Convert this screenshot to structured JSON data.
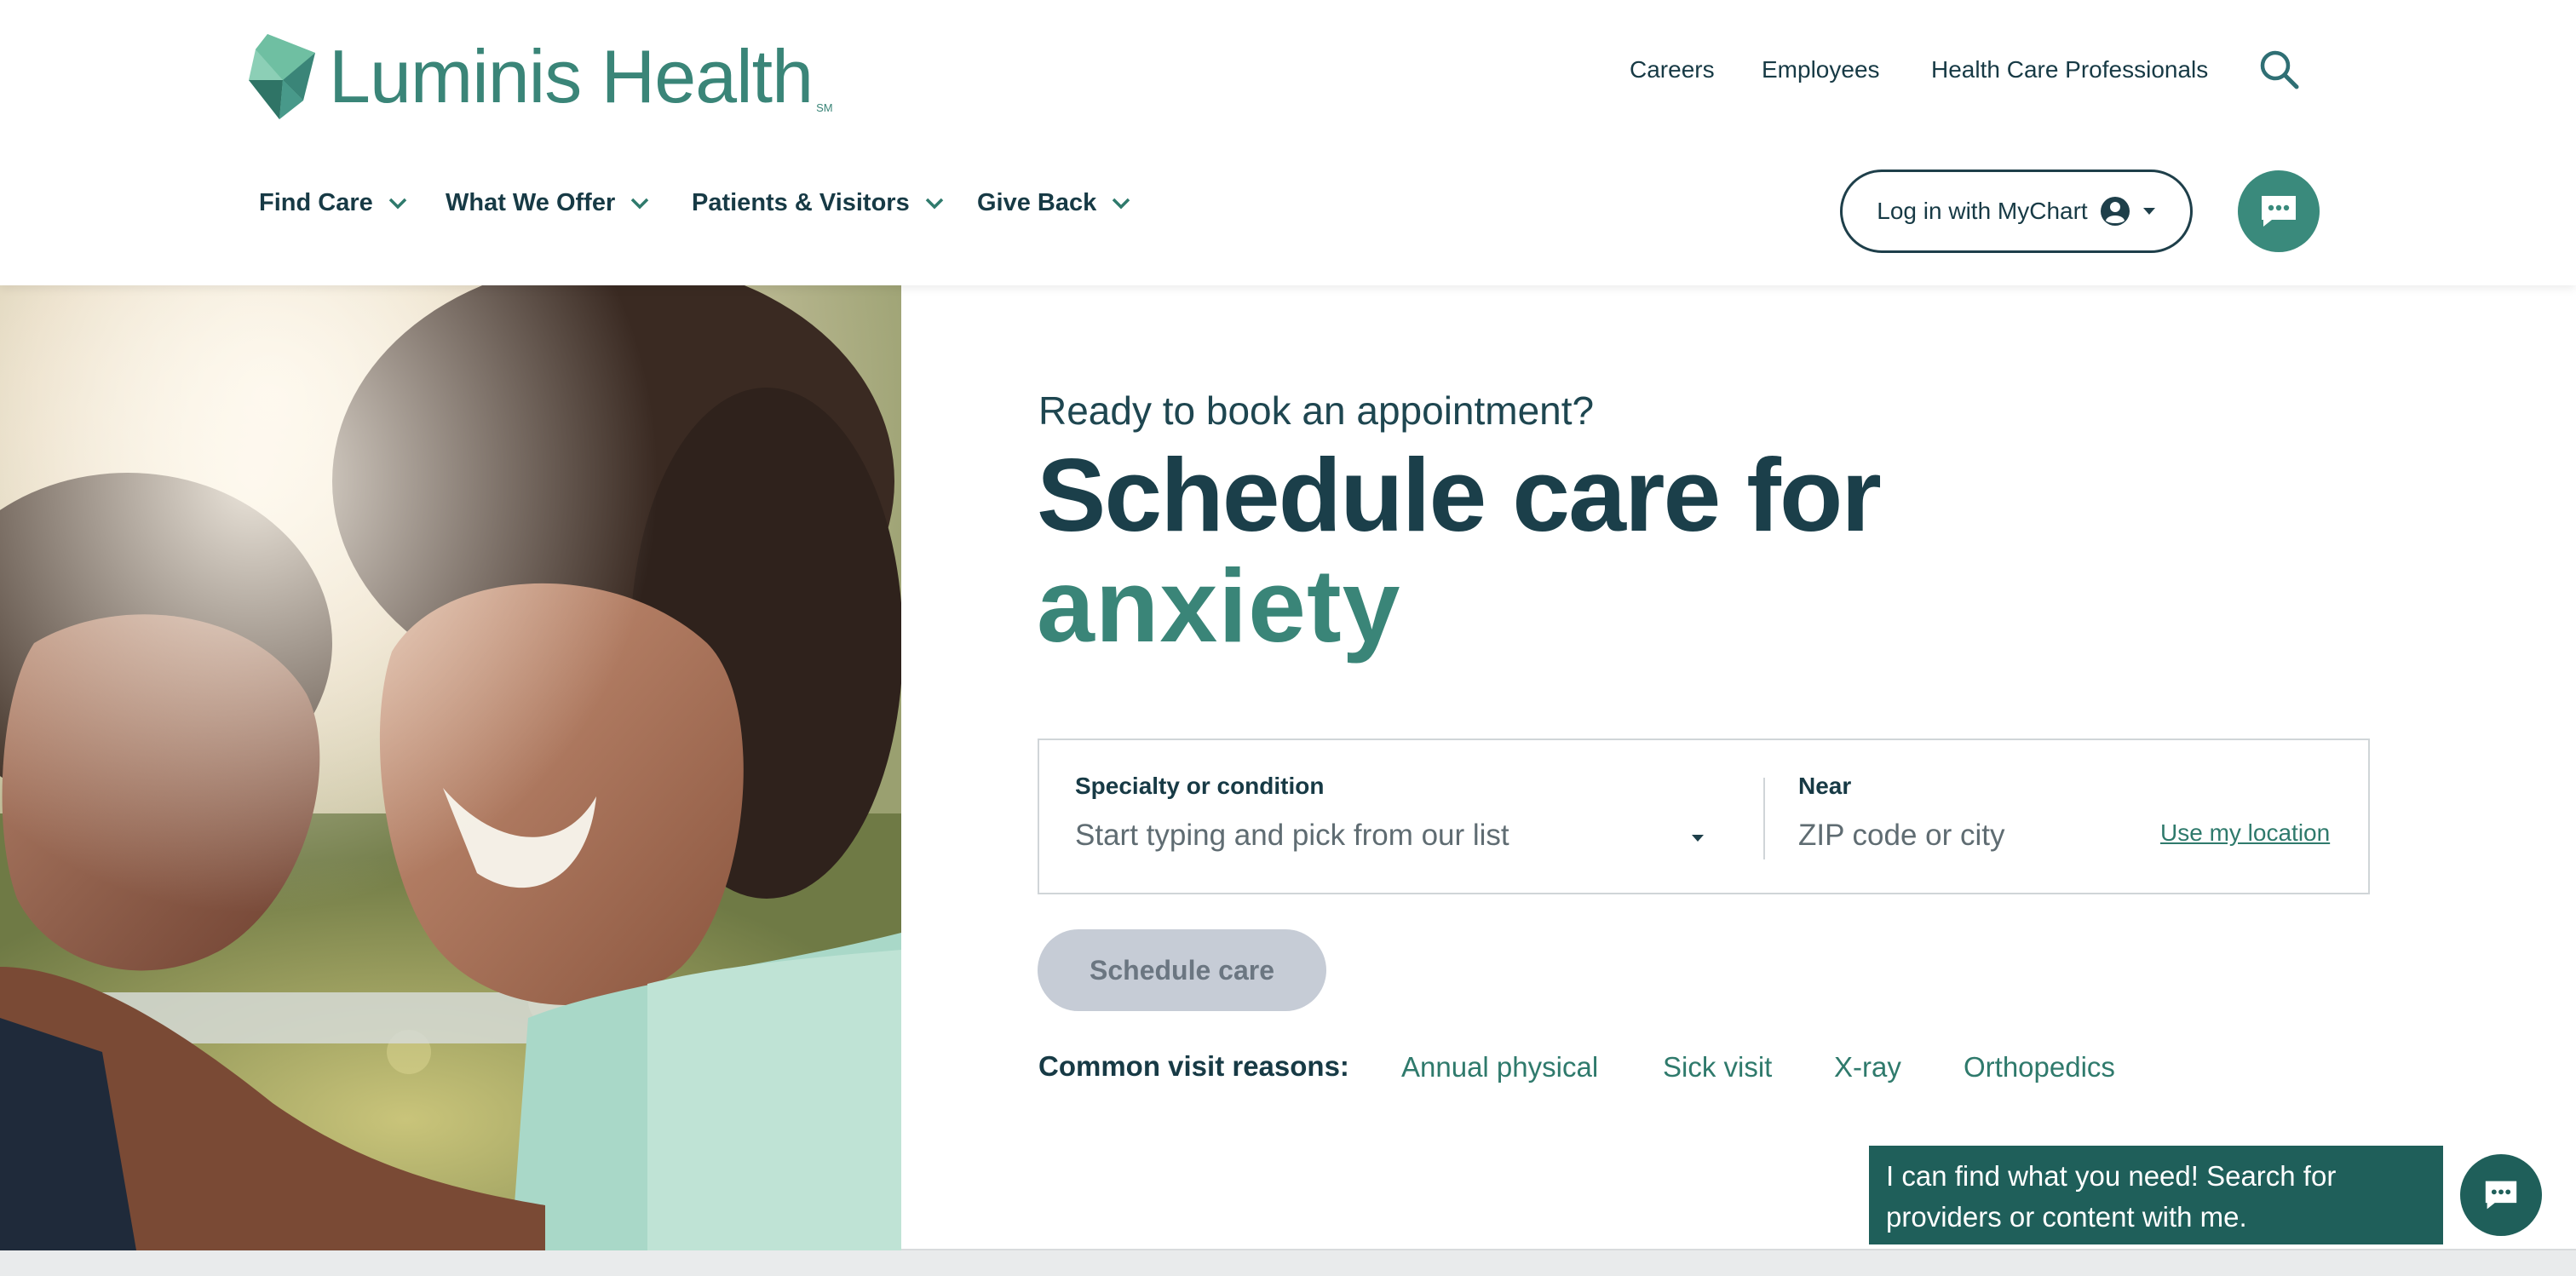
{
  "logo": {
    "text": "Luminis Health",
    "mark": "SM"
  },
  "utility_nav": [
    "Careers",
    "Employees",
    "Health Care Professionals"
  ],
  "main_nav": [
    "Find Care",
    "What We Offer",
    "Patients & Visitors",
    "Give Back"
  ],
  "mychart": {
    "label": "Log in with MyChart"
  },
  "hero": {
    "eyebrow": "Ready to book an appointment?",
    "headline_line1": "Schedule care for",
    "headline_line2": "anxiety"
  },
  "search": {
    "specialty_label": "Specialty or condition",
    "specialty_placeholder": "Start typing and pick from our list",
    "near_label": "Near",
    "near_placeholder": "ZIP code or city",
    "location_link": "Use my location"
  },
  "schedule_button": "Schedule care",
  "common_reasons": {
    "label": "Common visit reasons:",
    "items": [
      "Annual physical",
      "Sick visit",
      "X-ray",
      "Orthopedics"
    ]
  },
  "chat": {
    "bubble_text": "I can find what you need! Search for providers or content with me."
  },
  "colors": {
    "brand_teal": "#3a8578",
    "dark_navy": "#1b3f4a",
    "chat_green": "#1f5f5a",
    "disabled_button": "#c6ccd6"
  }
}
